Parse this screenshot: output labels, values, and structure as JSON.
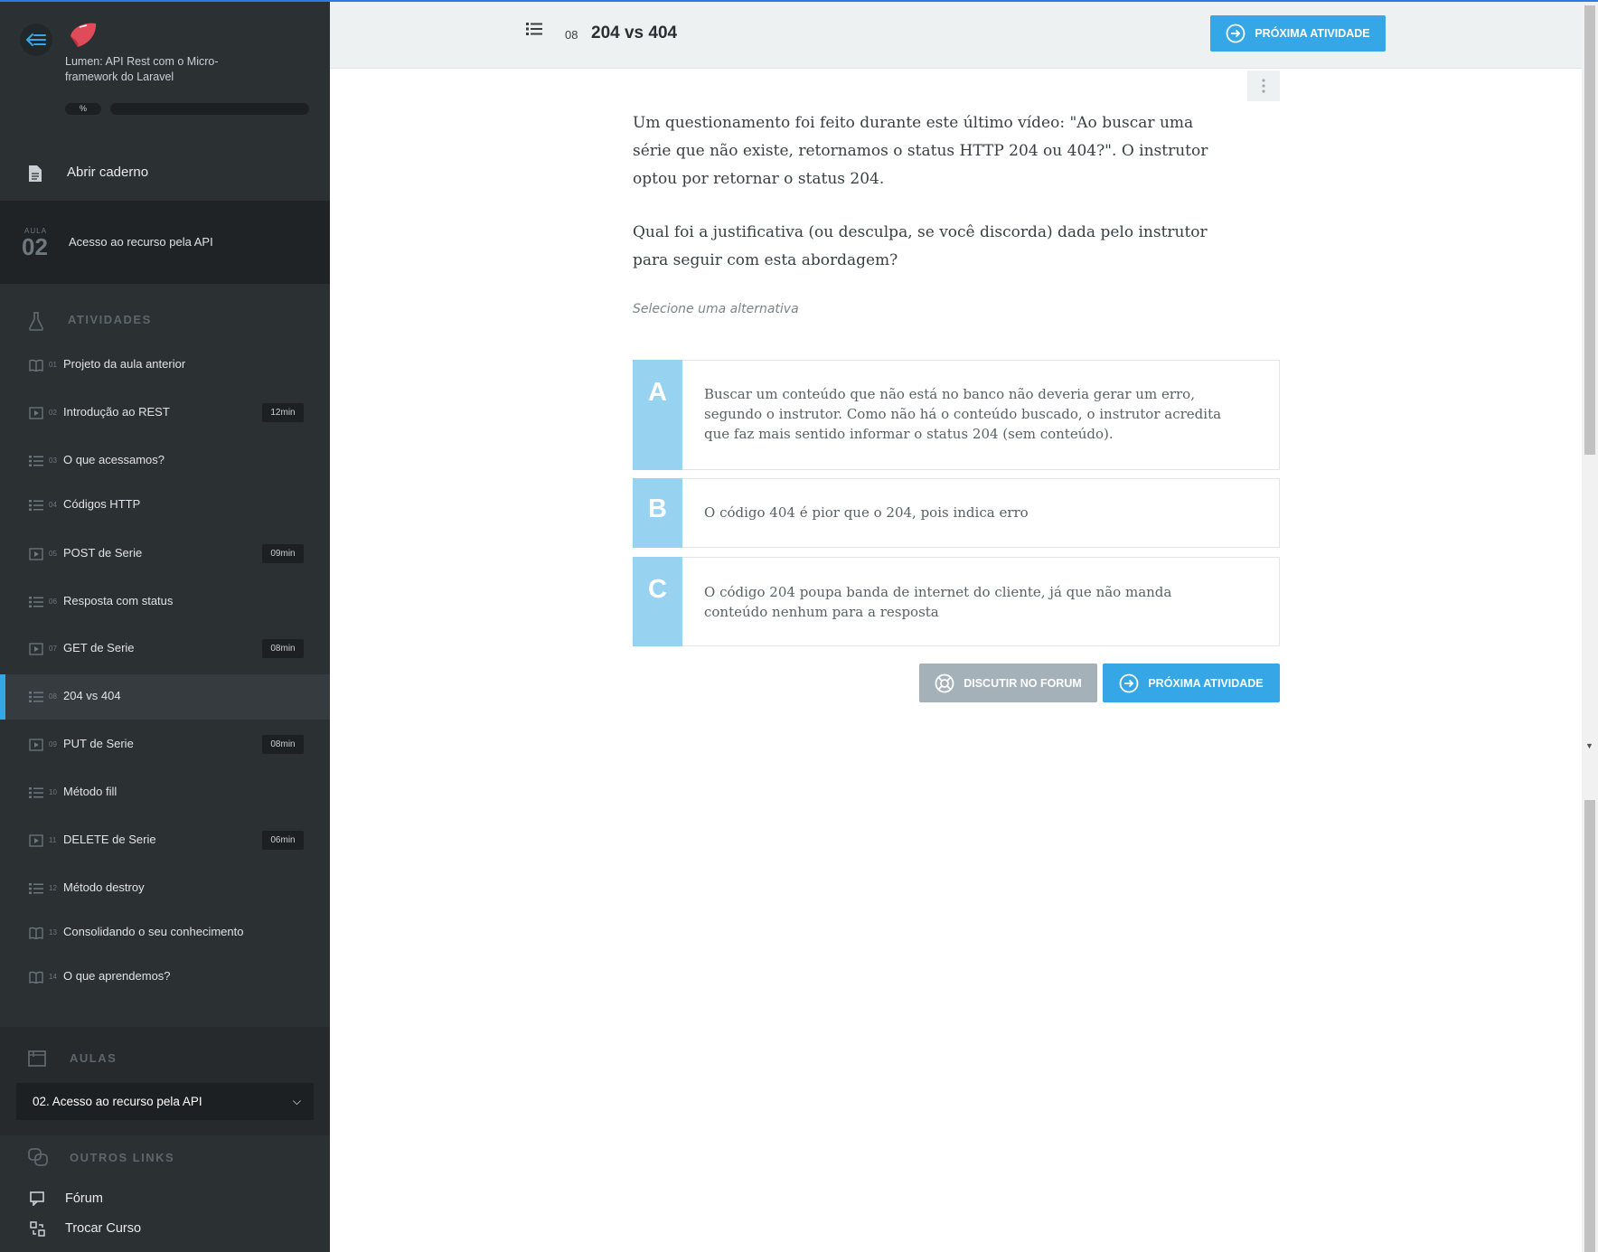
{
  "course": {
    "title": "Lumen: API Rest com o Micro-framework do Laravel",
    "progress_label": "%",
    "progress": 0
  },
  "sidebar": {
    "notebook_label": "Abrir caderno",
    "lesson": {
      "aula_label": "AULA",
      "number": "02",
      "title": "Acesso ao recurso pela API"
    },
    "activities_label": "ATIVIDADES",
    "activities": [
      {
        "num": "01",
        "title": "Projeto da aula anterior",
        "icon": "book-icon",
        "duration": ""
      },
      {
        "num": "02",
        "title": "Introdução ao REST",
        "icon": "video-icon",
        "duration": "12min"
      },
      {
        "num": "03",
        "title": "O que acessamos?",
        "icon": "list-icon",
        "duration": ""
      },
      {
        "num": "04",
        "title": "Códigos HTTP",
        "icon": "list-icon",
        "duration": ""
      },
      {
        "num": "05",
        "title": "POST de Serie",
        "icon": "video-icon",
        "duration": "09min"
      },
      {
        "num": "06",
        "title": "Resposta com status",
        "icon": "list-icon",
        "duration": ""
      },
      {
        "num": "07",
        "title": "GET de Serie",
        "icon": "video-icon",
        "duration": "08min"
      },
      {
        "num": "08",
        "title": "204 vs 404",
        "icon": "list-icon",
        "duration": "",
        "active": true
      },
      {
        "num": "09",
        "title": "PUT de Serie",
        "icon": "video-icon",
        "duration": "08min"
      },
      {
        "num": "10",
        "title": "Método fill",
        "icon": "list-icon",
        "duration": ""
      },
      {
        "num": "11",
        "title": "DELETE de Serie",
        "icon": "video-icon",
        "duration": "06min"
      },
      {
        "num": "12",
        "title": "Método destroy",
        "icon": "list-icon",
        "duration": ""
      },
      {
        "num": "13",
        "title": "Consolidando o seu conhecimento",
        "icon": "book-icon",
        "duration": ""
      },
      {
        "num": "14",
        "title": "O que aprendemos?",
        "icon": "book-icon",
        "duration": ""
      }
    ],
    "aulas_label": "AULAS",
    "aulas_selected": "02. Acesso ao recurso pela API",
    "other_links_label": "OUTROS LINKS",
    "other_links": [
      {
        "label": "Fórum",
        "icon": "forum-icon"
      },
      {
        "label": "Trocar Curso",
        "icon": "switch-course-icon"
      }
    ]
  },
  "topbar": {
    "activity_num": "08",
    "activity_title": "204 vs 404",
    "next_label": "PRÓXIMA ATIVIDADE"
  },
  "content": {
    "question_paragraphs": [
      "Um questionamento foi feito durante este último vídeo: \"Ao buscar uma série que não existe, retornamos o status HTTP 204 ou 404?\". O instrutor optou por retornar o status 204.",
      "Qual foi a justificativa (ou desculpa, se você discorda) dada pelo instrutor para seguir com esta abordagem?"
    ],
    "hint": "Selecione uma alternativa",
    "options": [
      {
        "letter": "A",
        "text": "Buscar um conteúdo que não está no banco não deveria gerar um erro, segundo o instrutor. Como não há o conteúdo buscado, o instrutor acredita que faz mais sentido informar o status 204 (sem conteúdo)."
      },
      {
        "letter": "B",
        "text": "O código 404 é pior que o 204, pois indica erro"
      },
      {
        "letter": "C",
        "text": "O código 204 poupa banda de internet do cliente, já que não manda conteúdo nenhum para a resposta"
      }
    ],
    "forum_label": "DISCUTIR NO FORUM",
    "next_label": "PRÓXIMA ATIVIDADE"
  },
  "colors": {
    "sidebar_bg": "#2b3033",
    "accent_blue": "#35a7e6",
    "option_letter_bg": "#98d2f1",
    "forum_button_bg": "#a5b1b8"
  }
}
